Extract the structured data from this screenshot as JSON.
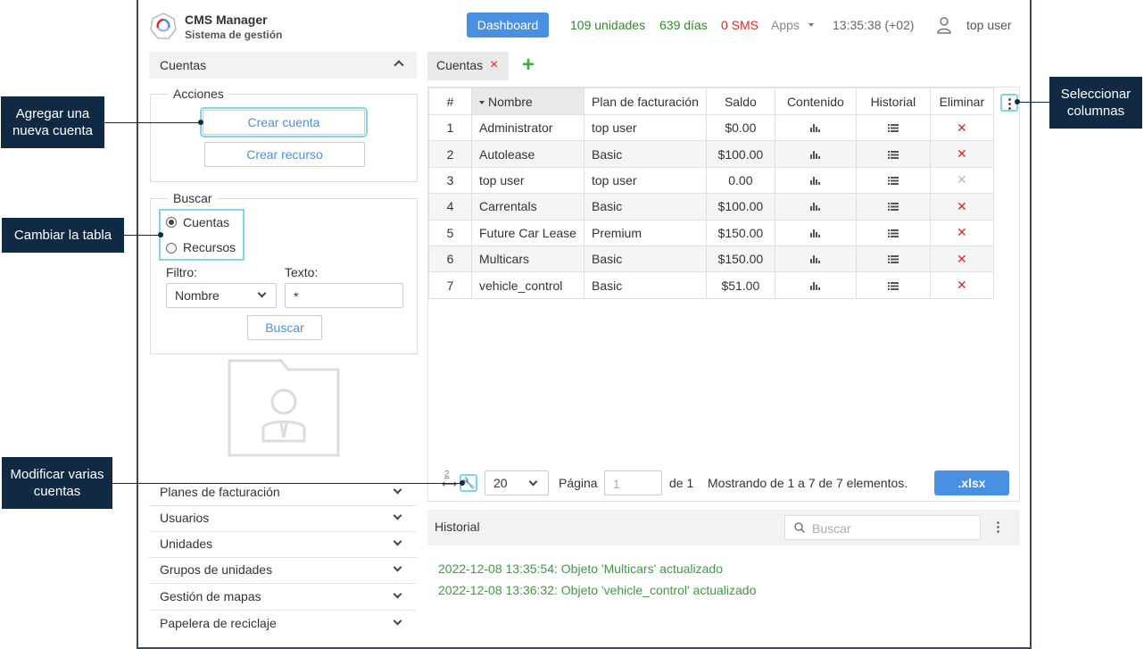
{
  "header": {
    "brand_title": "CMS Manager",
    "brand_subtitle": "Sistema de gestión",
    "dashboard_label": "Dashboard",
    "units": "109 unidades",
    "days": "639 días",
    "sms": "0 SMS",
    "apps_label": "Apps",
    "clock": "13:35:38 (+02)",
    "user": "top user"
  },
  "sidebar": {
    "section_title": "Cuentas",
    "actions_legend": "Acciones",
    "create_account": "Crear cuenta",
    "create_resource": "Crear recurso",
    "search_legend": "Buscar",
    "radio_accounts": "Cuentas",
    "radio_resources": "Recursos",
    "filter_label": "Filtro:",
    "filter_value": "Nombre",
    "text_label": "Texto:",
    "text_value": "*",
    "search_button": "Buscar",
    "accordion": [
      "Planes de facturación",
      "Usuarios",
      "Unidades",
      "Grupos de unidades",
      "Gestión de mapas",
      "Papelera de reciclaje"
    ]
  },
  "tabs": {
    "active": "Cuentas",
    "close_glyph": "×",
    "add_glyph": "+"
  },
  "table": {
    "headers": {
      "num": "#",
      "name": "Nombre",
      "plan": "Plan de facturación",
      "balance": "Saldo",
      "content": "Contenido",
      "history": "Historial",
      "delete": "Eliminar"
    },
    "rows": [
      {
        "n": "1",
        "name": "Administrator",
        "plan": "top user",
        "balance": "$0.00",
        "deletable": true
      },
      {
        "n": "2",
        "name": "Autolease",
        "plan": "Basic",
        "balance": "$100.00",
        "deletable": true
      },
      {
        "n": "3",
        "name": "top user",
        "plan": "top user",
        "balance": "0.00",
        "deletable": false
      },
      {
        "n": "4",
        "name": "Carrentals",
        "plan": "Basic",
        "balance": "$100.00",
        "deletable": true
      },
      {
        "n": "5",
        "name": "Future Car Lease",
        "plan": "Premium",
        "balance": "$150.00",
        "deletable": true
      },
      {
        "n": "6",
        "name": "Multicars",
        "plan": "Basic",
        "balance": "$150.00",
        "deletable": true
      },
      {
        "n": "7",
        "name": "vehicle_control",
        "plan": "Basic",
        "balance": "$51.00",
        "deletable": true
      }
    ]
  },
  "pager": {
    "selected_count": "2",
    "page_size": "20",
    "page_label": "Página",
    "page_value": "1",
    "of_label": "de 1",
    "showing": "Mostrando de 1 a 7 de 7 elementos.",
    "export_label": ".xlsx"
  },
  "history": {
    "title": "Historial",
    "search_placeholder": "Buscar",
    "entries": [
      "2022-12-08 13:35:54: Objeto 'Multicars' actualizado",
      "2022-12-08 13:36:32: Objeto 'vehicle_control' actualizado"
    ]
  },
  "callouts": {
    "add_account": "Agregar una nueva cuenta",
    "switch_table": "Cambiar la tabla",
    "modify_accounts": "Modificar varias cuentas",
    "select_columns": "Seleccionar columnas"
  },
  "colors": {
    "accent": "#4a90e2",
    "callout": "#102a43",
    "highlight": "#7fd6e8",
    "success": "#2e8b2e",
    "danger": "#d92b2b"
  }
}
